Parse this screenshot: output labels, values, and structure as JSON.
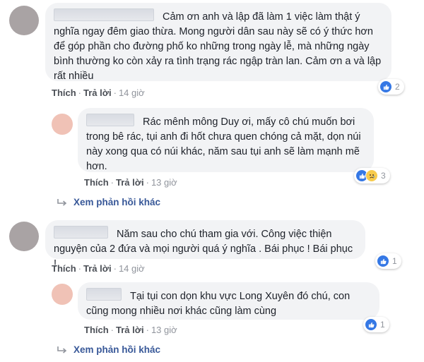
{
  "comments": [
    {
      "text": "Cảm ơn anh và lập đã làm 1 việc làm thật ý nghĩa ngay đêm giao thừa. Mong người dân sau này sẽ có ý thức hơn để góp phần cho đường phố ko những trong ngày lễ, mà những ngày bình thường ko còn xảy ra tình trạng rác ngập tràn lan. Cảm ơn a và lập rất nhiều",
      "like_label": "Thích",
      "reply_label": "Trả lời",
      "time": "14 giờ",
      "reaction_count": "2"
    },
    {
      "text": "Rác mênh mông Duy ơi, mấy cô chú muốn bơi trong bê rác, tụi anh đi hốt chưa quen chóng cả mặt, dọn núi này xong qua có núi khác, năm sau tụi anh sẽ làm mạnh mẽ hơn.",
      "like_label": "Thích",
      "reply_label": "Trả lời",
      "time": "13 giờ",
      "reaction_count": "3"
    },
    {
      "more_label": "Xem phản hồi khác"
    },
    {
      "text": "Năm sau cho chú tham gia với. Công việc thiện nguyện của 2 đứa và mọi người quá ý nghĩa . Bái phục ! Bái phục !",
      "like_label": "Thích",
      "reply_label": "Trả lời",
      "time": "14 giờ",
      "reaction_count": "1"
    },
    {
      "text": "Tại tụi con dọn khu vực Long Xuyên đó chú, con cũng mong nhiều nơi khác cũng làm cùng",
      "like_label": "Thích",
      "reply_label": "Trả lời",
      "time": "13 giờ",
      "reaction_count": "1"
    },
    {
      "more_label": "Xem phản hồi khác"
    }
  ],
  "separator": "·",
  "colors": {
    "like_blue": "#3578e5",
    "link_blue": "#385898",
    "bubble": "#f2f3f5"
  },
  "icons": [
    "like-icon",
    "sad-icon",
    "reply-arrow-icon"
  ]
}
